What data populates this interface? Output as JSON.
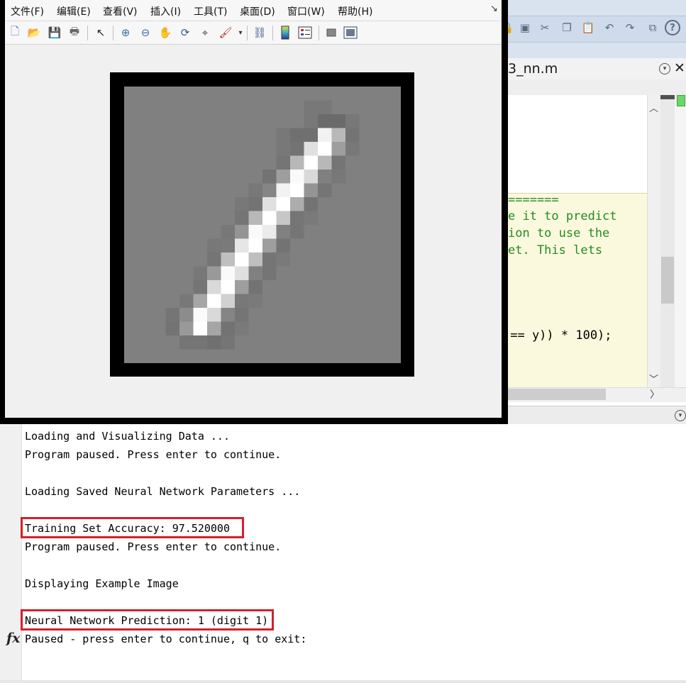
{
  "figure": {
    "menu": [
      "文件(F)",
      "编辑(E)",
      "查看(V)",
      "插入(I)",
      "工具(T)",
      "桌面(D)",
      "窗口(W)",
      "帮助(H)"
    ],
    "toolbar_icons": [
      "new-figure-icon",
      "open-file-icon",
      "save-icon",
      "print-icon",
      "pointer-icon",
      "zoom-in-icon",
      "zoom-out-icon",
      "pan-icon",
      "rotate-3d-icon",
      "data-cursor-icon",
      "brush-icon",
      "link-plot-icon",
      "colorbar-icon",
      "legend-icon",
      "hide-plot-tools-icon",
      "show-plot-tools-icon"
    ],
    "image": {
      "size": 20,
      "pixels": [
        [
          0.5,
          0.5,
          0.5,
          0.5,
          0.5,
          0.5,
          0.5,
          0.5,
          0.5,
          0.5,
          0.5,
          0.5,
          0.5,
          0.5,
          0.5,
          0.5,
          0.5,
          0.5,
          0.5,
          0.5
        ],
        [
          0.5,
          0.5,
          0.5,
          0.5,
          0.5,
          0.5,
          0.5,
          0.5,
          0.5,
          0.5,
          0.5,
          0.5,
          0.5,
          0.47,
          0.47,
          0.5,
          0.5,
          0.5,
          0.5,
          0.5
        ],
        [
          0.5,
          0.5,
          0.5,
          0.5,
          0.5,
          0.5,
          0.5,
          0.5,
          0.5,
          0.5,
          0.5,
          0.5,
          0.5,
          0.47,
          0.42,
          0.42,
          0.47,
          0.5,
          0.5,
          0.5
        ],
        [
          0.5,
          0.5,
          0.5,
          0.5,
          0.5,
          0.5,
          0.5,
          0.5,
          0.5,
          0.5,
          0.5,
          0.47,
          0.44,
          0.44,
          0.95,
          0.72,
          0.45,
          0.5,
          0.5,
          0.5
        ],
        [
          0.5,
          0.5,
          0.5,
          0.5,
          0.5,
          0.5,
          0.5,
          0.5,
          0.5,
          0.5,
          0.5,
          0.47,
          0.45,
          0.88,
          1.0,
          0.62,
          0.47,
          0.5,
          0.5,
          0.5
        ],
        [
          0.5,
          0.5,
          0.5,
          0.5,
          0.5,
          0.5,
          0.5,
          0.5,
          0.5,
          0.5,
          0.5,
          0.46,
          0.72,
          1.0,
          0.72,
          0.46,
          0.5,
          0.5,
          0.5,
          0.5
        ],
        [
          0.5,
          0.5,
          0.5,
          0.5,
          0.5,
          0.5,
          0.5,
          0.5,
          0.5,
          0.5,
          0.45,
          0.62,
          0.98,
          0.85,
          0.5,
          0.47,
          0.5,
          0.5,
          0.5,
          0.5
        ],
        [
          0.5,
          0.5,
          0.5,
          0.5,
          0.5,
          0.5,
          0.5,
          0.5,
          0.5,
          0.47,
          0.52,
          0.95,
          1.0,
          0.58,
          0.46,
          0.5,
          0.5,
          0.5,
          0.5,
          0.5
        ],
        [
          0.5,
          0.5,
          0.5,
          0.5,
          0.5,
          0.5,
          0.5,
          0.5,
          0.47,
          0.45,
          0.88,
          1.0,
          0.68,
          0.45,
          0.5,
          0.5,
          0.5,
          0.5,
          0.5,
          0.5
        ],
        [
          0.5,
          0.5,
          0.5,
          0.5,
          0.5,
          0.5,
          0.5,
          0.5,
          0.46,
          0.72,
          1.0,
          0.78,
          0.46,
          0.48,
          0.5,
          0.5,
          0.5,
          0.5,
          0.5,
          0.5
        ],
        [
          0.5,
          0.5,
          0.5,
          0.5,
          0.5,
          0.5,
          0.5,
          0.47,
          0.58,
          0.98,
          0.92,
          0.5,
          0.46,
          0.5,
          0.5,
          0.5,
          0.5,
          0.5,
          0.5,
          0.5
        ],
        [
          0.5,
          0.5,
          0.5,
          0.5,
          0.5,
          0.5,
          0.47,
          0.48,
          0.9,
          1.0,
          0.62,
          0.45,
          0.5,
          0.5,
          0.5,
          0.5,
          0.5,
          0.5,
          0.5,
          0.5
        ],
        [
          0.5,
          0.5,
          0.5,
          0.5,
          0.5,
          0.5,
          0.46,
          0.75,
          1.0,
          0.75,
          0.46,
          0.48,
          0.5,
          0.5,
          0.5,
          0.5,
          0.5,
          0.5,
          0.5,
          0.5
        ],
        [
          0.5,
          0.5,
          0.5,
          0.5,
          0.5,
          0.47,
          0.6,
          0.98,
          0.88,
          0.5,
          0.46,
          0.5,
          0.5,
          0.5,
          0.5,
          0.5,
          0.5,
          0.5,
          0.5,
          0.5
        ],
        [
          0.5,
          0.5,
          0.5,
          0.5,
          0.5,
          0.46,
          0.85,
          1.0,
          0.62,
          0.45,
          0.5,
          0.5,
          0.5,
          0.5,
          0.5,
          0.5,
          0.5,
          0.5,
          0.5,
          0.5
        ],
        [
          0.5,
          0.5,
          0.5,
          0.5,
          0.47,
          0.65,
          1.0,
          0.82,
          0.47,
          0.48,
          0.5,
          0.5,
          0.5,
          0.5,
          0.5,
          0.5,
          0.5,
          0.5,
          0.5,
          0.5
        ],
        [
          0.5,
          0.5,
          0.5,
          0.46,
          0.55,
          0.98,
          0.85,
          0.52,
          0.46,
          0.5,
          0.5,
          0.5,
          0.5,
          0.5,
          0.5,
          0.5,
          0.5,
          0.5,
          0.5,
          0.5
        ],
        [
          0.5,
          0.5,
          0.5,
          0.45,
          0.6,
          1.0,
          0.65,
          0.45,
          0.48,
          0.5,
          0.5,
          0.5,
          0.5,
          0.5,
          0.5,
          0.5,
          0.5,
          0.5,
          0.5,
          0.5
        ],
        [
          0.5,
          0.5,
          0.5,
          0.5,
          0.46,
          0.46,
          0.44,
          0.46,
          0.5,
          0.5,
          0.5,
          0.5,
          0.5,
          0.5,
          0.5,
          0.5,
          0.5,
          0.5,
          0.5,
          0.5
        ],
        [
          0.5,
          0.5,
          0.5,
          0.5,
          0.5,
          0.5,
          0.5,
          0.5,
          0.5,
          0.5,
          0.5,
          0.5,
          0.5,
          0.5,
          0.5,
          0.5,
          0.5,
          0.5,
          0.5,
          0.5
        ]
      ]
    }
  },
  "editor": {
    "tab_name": "3_nn.m",
    "lines": [
      {
        "text": ")",
        "style": "black"
      },
      {
        "text": "=======",
        "style": "green"
      },
      {
        "text": "e it to predict",
        "style": "green"
      },
      {
        "text": "ion to use the",
        "style": "green"
      },
      {
        "text": "et. This lets",
        "style": "green"
      },
      {
        "text": " == y)) * 100);",
        "style": "black"
      }
    ]
  },
  "command_window": {
    "lines": [
      "Loading and Visualizing Data ...",
      "Program paused. Press enter to continue.",
      "",
      "Loading Saved Neural Network Parameters ...",
      "",
      "Training Set Accuracy: 97.520000",
      "Program paused. Press enter to continue.",
      "",
      "Displaying Example Image",
      "",
      "Neural Network Prediction: 1 (digit 1)",
      "Paused - press enter to continue, q to exit:"
    ],
    "highlighted_lines": [
      5,
      10
    ],
    "highlight_color": "#d4202a",
    "prompt_icon": "fx-icon"
  },
  "desktop_toolbar_icons": [
    "lock-icon",
    "save-icon",
    "cut-icon",
    "copy-icon",
    "paste-icon",
    "undo-icon",
    "redo-icon",
    "window-icon",
    "help-icon"
  ]
}
